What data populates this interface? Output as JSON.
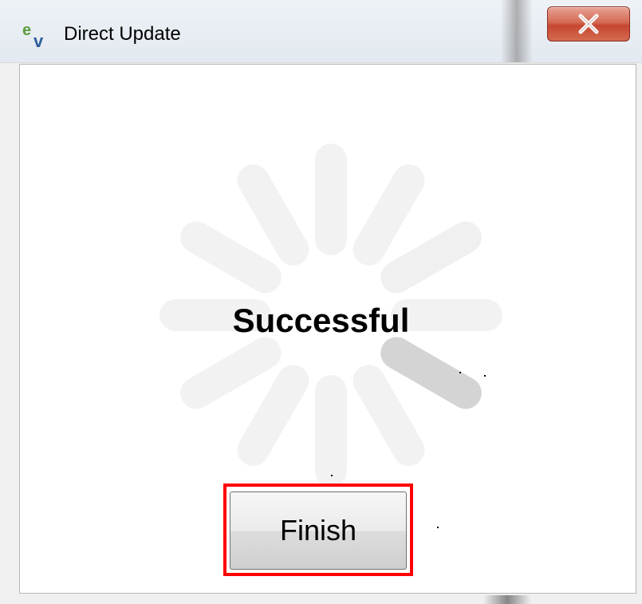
{
  "window": {
    "title": "Direct Update",
    "app_icon": "ev-logo-icon",
    "close_icon": "close-icon"
  },
  "main": {
    "status_text": "Successful",
    "spinner_icon": "loading-spinner-icon"
  },
  "actions": {
    "finish_label": "Finish"
  },
  "colors": {
    "highlight": "#ff0000",
    "close_button": "#c64631",
    "icon_green": "#5a9e3c",
    "icon_blue": "#2d5f9a"
  }
}
